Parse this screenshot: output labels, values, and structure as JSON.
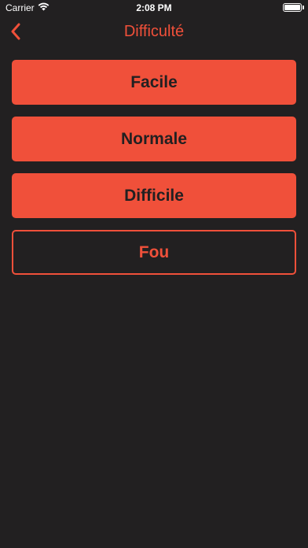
{
  "status_bar": {
    "carrier": "Carrier",
    "time": "2:08 PM",
    "battery_level": 1.0
  },
  "nav": {
    "title": "Difficulté",
    "back_icon": "chevron-left-icon"
  },
  "colors": {
    "accent": "#f0503a",
    "background": "#222021"
  },
  "difficulty_options": [
    {
      "label": "Facile",
      "selected": false
    },
    {
      "label": "Normale",
      "selected": false
    },
    {
      "label": "Difficile",
      "selected": false
    },
    {
      "label": "Fou",
      "selected": true
    }
  ]
}
